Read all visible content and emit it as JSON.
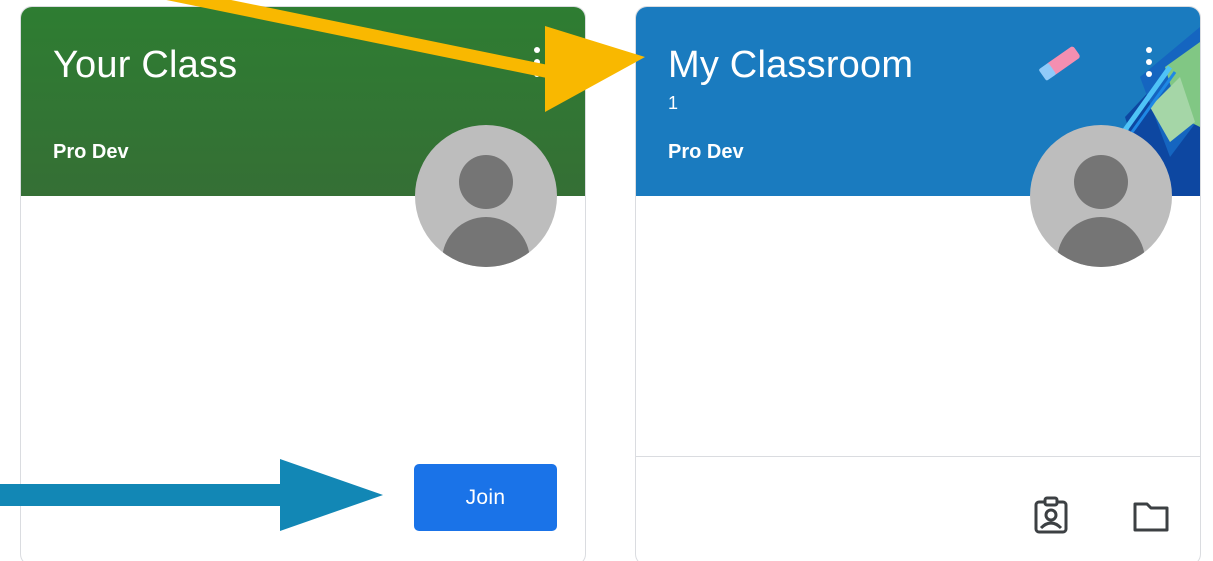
{
  "cards": [
    {
      "title": "Your Class",
      "section": "",
      "owner": "Pro Dev",
      "theme_color": "#2e7d32",
      "action_label": "Join",
      "menu_icon": "more-vert-icon",
      "avatar_icon": "default-avatar-icon"
    },
    {
      "title": "My Classroom",
      "section": "1",
      "owner": "Pro Dev",
      "theme_color": "#1a7bbf",
      "menu_icon": "more-vert-icon",
      "avatar_icon": "default-avatar-icon",
      "footer_icons": [
        "assignment-ind-icon",
        "folder-icon"
      ]
    }
  ],
  "annotations": {
    "arrow_to_title_color": "#f9b800",
    "arrow_to_join_color": "#1287b5"
  },
  "colors": {
    "join_button": "#1a73e8"
  }
}
